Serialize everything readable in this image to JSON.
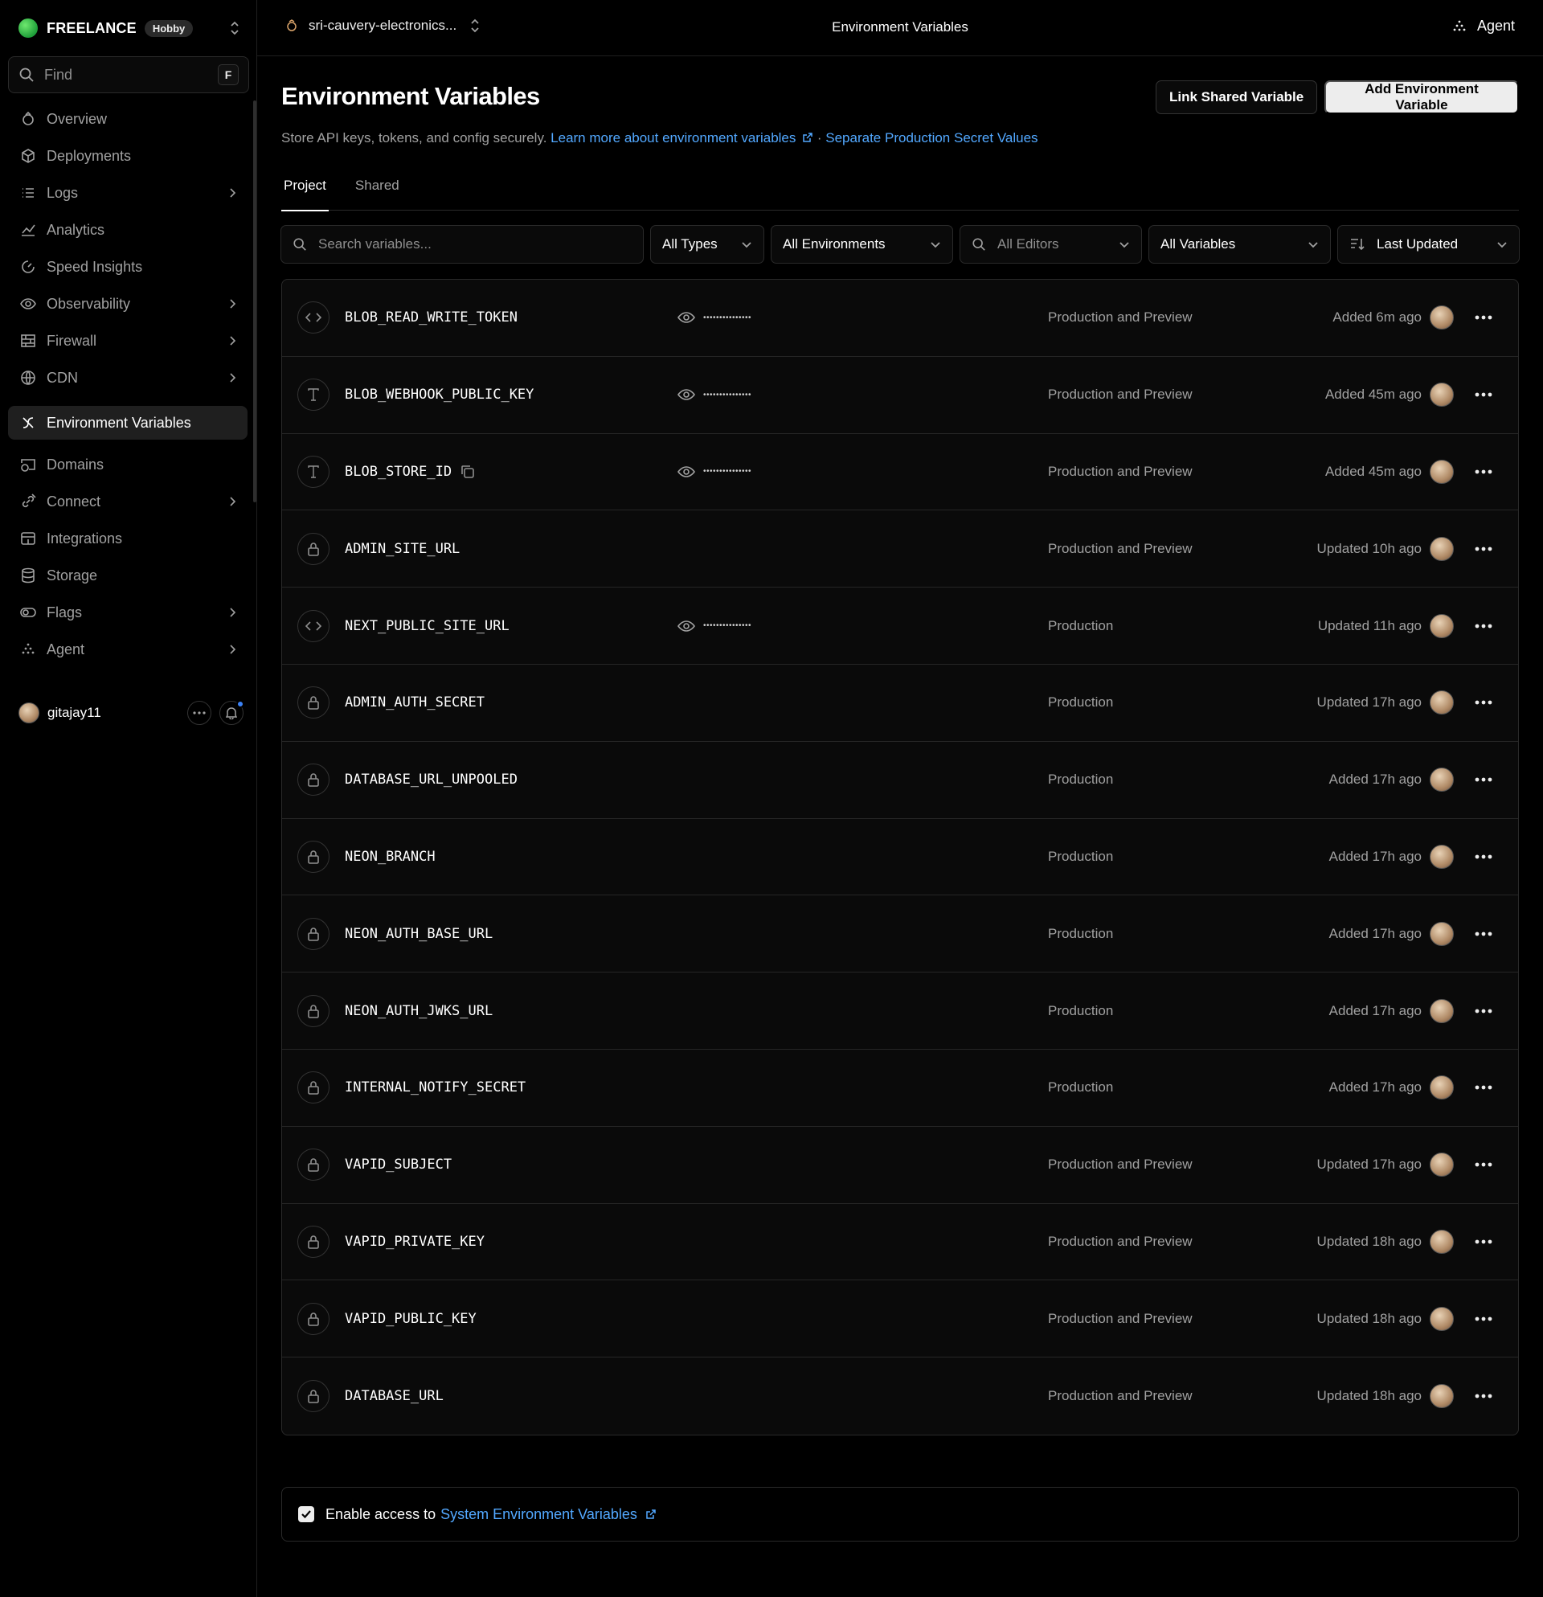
{
  "team": {
    "name": "FREELANCE",
    "plan": "Hobby"
  },
  "search": {
    "placeholder": "Find",
    "shortcut": "F"
  },
  "sidebar": {
    "items": [
      {
        "label": "Overview",
        "icon": "overview-icon",
        "chevron": false
      },
      {
        "label": "Deployments",
        "icon": "deployments-icon",
        "chevron": false
      },
      {
        "label": "Logs",
        "icon": "logs-icon",
        "chevron": true
      },
      {
        "label": "Analytics",
        "icon": "analytics-icon",
        "chevron": false
      },
      {
        "label": "Speed Insights",
        "icon": "speed-insights-icon",
        "chevron": false
      },
      {
        "label": "Observability",
        "icon": "observability-icon",
        "chevron": true
      },
      {
        "label": "Firewall",
        "icon": "firewall-icon",
        "chevron": true
      },
      {
        "label": "CDN",
        "icon": "globe-icon",
        "chevron": true
      },
      {
        "label": "Environment Variables",
        "icon": "env-vars-icon",
        "chevron": false,
        "active": true
      },
      {
        "label": "Domains",
        "icon": "domains-icon",
        "chevron": false
      },
      {
        "label": "Connect",
        "icon": "connect-icon",
        "chevron": true
      },
      {
        "label": "Integrations",
        "icon": "integrations-icon",
        "chevron": false
      },
      {
        "label": "Storage",
        "icon": "storage-icon",
        "chevron": false
      },
      {
        "label": "Flags",
        "icon": "flags-icon",
        "chevron": true
      },
      {
        "label": "Agent",
        "icon": "agent-icon",
        "chevron": true
      }
    ]
  },
  "user": {
    "name": "gitajay11"
  },
  "topbar": {
    "project": "sri-cauvery-electronics...",
    "title": "Environment Variables",
    "agent_label": "Agent"
  },
  "page": {
    "title": "Environment Variables",
    "subtitle_text": "Store API keys, tokens, and config securely.",
    "learn_more_link": "Learn more about environment variables",
    "separator": "·",
    "secret_link": "Separate Production Secret Values",
    "link_shared_button": "Link Shared Variable",
    "add_button": "Add Environment Variable",
    "tabs": [
      "Project",
      "Shared"
    ]
  },
  "filters": {
    "search_placeholder": "Search variables...",
    "types": "All Types",
    "environments": "All Environments",
    "editors_placeholder": "All Editors",
    "variables": "All Variables",
    "sort": "Last Updated"
  },
  "variables": [
    {
      "name": "BLOB_READ_WRITE_TOKEN",
      "type_icon": "code-icon",
      "masked": "•••••••••••••••",
      "copy": false,
      "env": "Production and Preview",
      "updated": "Added 6m ago"
    },
    {
      "name": "BLOB_WEBHOOK_PUBLIC_KEY",
      "type_icon": "text-icon",
      "masked": "•••••••••••••••",
      "copy": false,
      "env": "Production and Preview",
      "updated": "Added 45m ago"
    },
    {
      "name": "BLOB_STORE_ID",
      "type_icon": "text-icon",
      "masked": "•••••••••••••••",
      "copy": true,
      "env": "Production and Preview",
      "updated": "Added 45m ago"
    },
    {
      "name": "ADMIN_SITE_URL",
      "type_icon": "lock-icon",
      "masked": "",
      "copy": false,
      "env": "Production and Preview",
      "updated": "Updated 10h ago"
    },
    {
      "name": "NEXT_PUBLIC_SITE_URL",
      "type_icon": "code-icon",
      "masked": "•••••••••••••••",
      "copy": false,
      "env": "Production",
      "updated": "Updated 11h ago"
    },
    {
      "name": "ADMIN_AUTH_SECRET",
      "type_icon": "lock-icon",
      "masked": "",
      "copy": false,
      "env": "Production",
      "updated": "Updated 17h ago"
    },
    {
      "name": "DATABASE_URL_UNPOOLED",
      "type_icon": "lock-icon",
      "masked": "",
      "copy": false,
      "env": "Production",
      "updated": "Added 17h ago"
    },
    {
      "name": "NEON_BRANCH",
      "type_icon": "lock-icon",
      "masked": "",
      "copy": false,
      "env": "Production",
      "updated": "Added 17h ago"
    },
    {
      "name": "NEON_AUTH_BASE_URL",
      "type_icon": "lock-icon",
      "masked": "",
      "copy": false,
      "env": "Production",
      "updated": "Added 17h ago"
    },
    {
      "name": "NEON_AUTH_JWKS_URL",
      "type_icon": "lock-icon",
      "masked": "",
      "copy": false,
      "env": "Production",
      "updated": "Added 17h ago"
    },
    {
      "name": "INTERNAL_NOTIFY_SECRET",
      "type_icon": "lock-icon",
      "masked": "",
      "copy": false,
      "env": "Production",
      "updated": "Added 17h ago"
    },
    {
      "name": "VAPID_SUBJECT",
      "type_icon": "lock-icon",
      "masked": "",
      "copy": false,
      "env": "Production and Preview",
      "updated": "Updated 17h ago"
    },
    {
      "name": "VAPID_PRIVATE_KEY",
      "type_icon": "lock-icon",
      "masked": "",
      "copy": false,
      "env": "Production and Preview",
      "updated": "Updated 18h ago"
    },
    {
      "name": "VAPID_PUBLIC_KEY",
      "type_icon": "lock-icon",
      "masked": "",
      "copy": false,
      "env": "Production and Preview",
      "updated": "Updated 18h ago"
    },
    {
      "name": "DATABASE_URL",
      "type_icon": "lock-icon",
      "masked": "",
      "copy": false,
      "env": "Production and Preview",
      "updated": "Updated 18h ago"
    }
  ],
  "system_vars": {
    "checked": true,
    "label": "Enable access to",
    "link": "System Environment Variables"
  },
  "colors": {
    "accent_link": "#52a8ff",
    "brand_green": "#2fbf4a",
    "notification": "#3b82f6"
  }
}
